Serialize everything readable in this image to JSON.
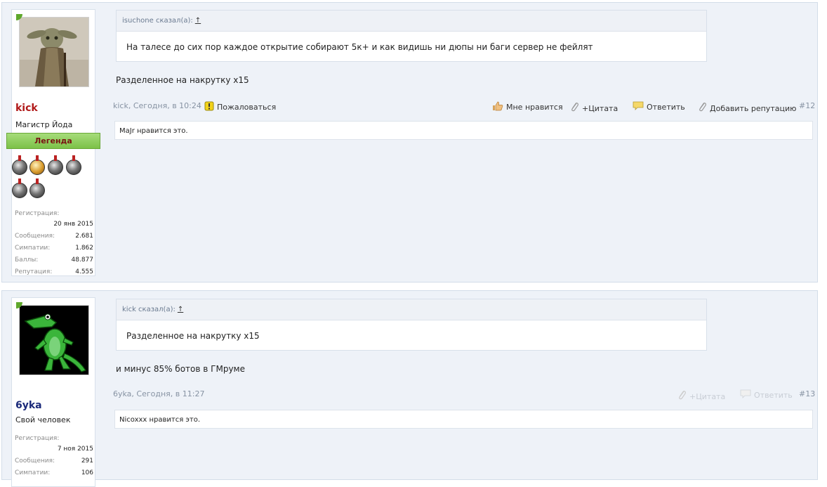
{
  "posts": [
    {
      "user": {
        "name": "kick",
        "title": "Магистр Йода",
        "rank": "Легенда",
        "avatar_icon": "yoda-avatar",
        "stats": {
          "reg_label": "Регистрация:",
          "reg_value": "20 янв 2015",
          "msgs_label": "Сообщения:",
          "msgs_value": "2.681",
          "likes_label": "Симпатии:",
          "likes_value": "1.862",
          "points_label": "Баллы:",
          "points_value": "48.877",
          "rep_label": "Репутация:",
          "rep_value": "4.555"
        }
      },
      "quote": {
        "head": "isuchone сказал(а):",
        "up": "↑",
        "text": "На талесе до сих пор каждое открытие собирают 5к+ и как видишь ни дюпы ни баги сервер не фейлят"
      },
      "message": "Разделенное на накрутку х15",
      "meta": {
        "author_date": "kick, Сегодня, в 10:24",
        "report": "Пожаловаться",
        "like": "Мне нравится",
        "quote": "+Цитата",
        "reply": "Ответить",
        "add_rep": "Добавить репутацию",
        "number": "#12"
      },
      "likes_text": "MaJr нравится это."
    },
    {
      "user": {
        "name": "6yka",
        "title": "Свой человек",
        "avatar_icon": "crocodile-avatar",
        "stats": {
          "reg_label": "Регистрация:",
          "reg_value": "7 ноя 2015",
          "msgs_label": "Сообщения:",
          "msgs_value": "291",
          "likes_label": "Симпатии:",
          "likes_value": "106"
        }
      },
      "quote": {
        "head": "kick сказал(а):",
        "up": "↑",
        "text": "Разделенное на накрутку х15"
      },
      "message": "и минус 85% ботов в ГМруме",
      "meta": {
        "author_date": "6yka, Сегодня, в 11:27",
        "quote": "+Цитата",
        "reply": "Ответить",
        "number": "#13"
      },
      "likes_text": "Nicoxxx нравится это."
    }
  ],
  "colors": {
    "post_bg": "#eef2f8",
    "username_kick": "#b01818",
    "username_6yka": "#1b2a7a",
    "legend_green": "#7cc148"
  }
}
